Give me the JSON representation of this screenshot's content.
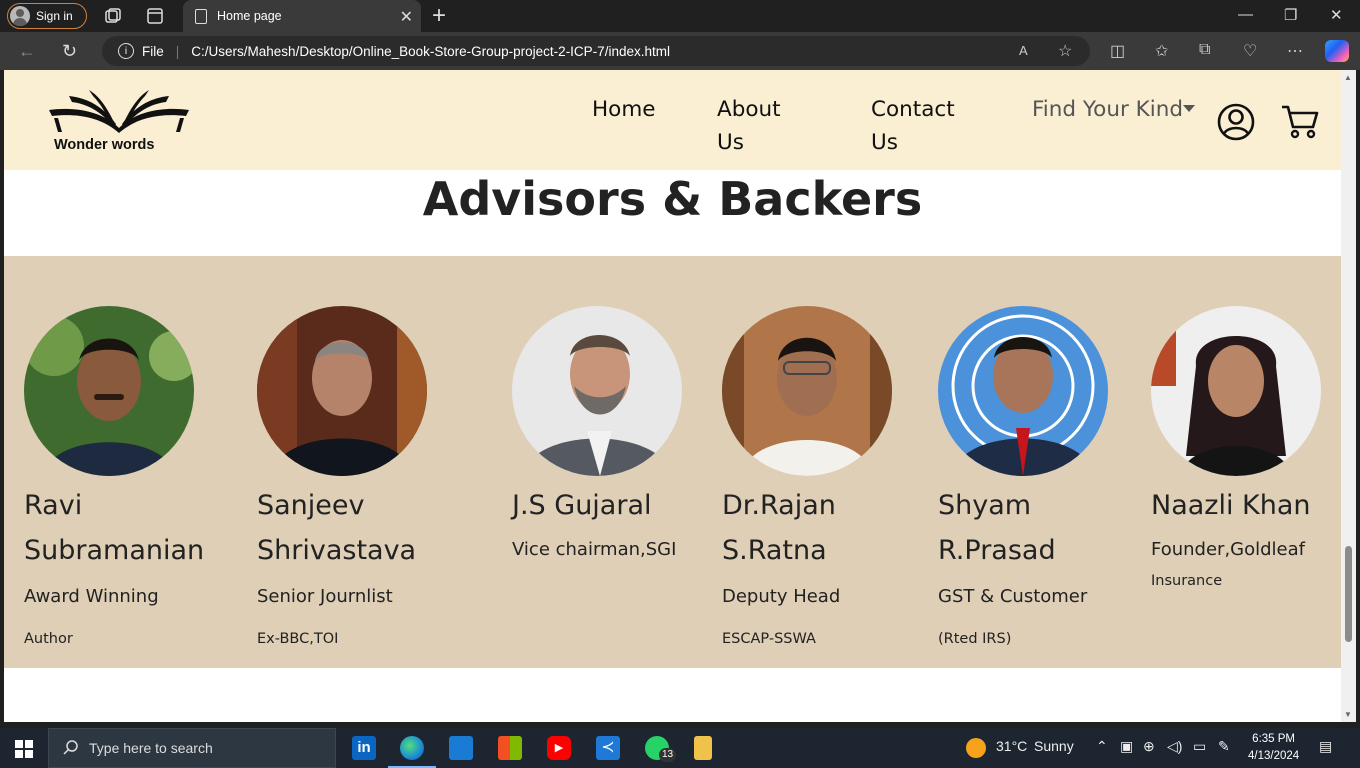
{
  "browser": {
    "signin_label": "Sign in",
    "tab_title": "Home page",
    "address_prefix": "File",
    "url": "C:/Users/Mahesh/Desktop/Online_Book-Store-Group-project-2-ICP-7/index.html"
  },
  "site": {
    "logo_text": "Wonder words",
    "nav": [
      {
        "label": "Home"
      },
      {
        "label": "About\nUs"
      },
      {
        "label": "Contact\nUs"
      }
    ],
    "dropdown_label": "Find Your Kind"
  },
  "advisors": {
    "title": "Advisors & Backers",
    "people": [
      {
        "name": "Ravi\nSubramanian",
        "role": "Award Winning",
        "sub": "Author"
      },
      {
        "name": "Sanjeev\nShrivastava",
        "role": "Senior Journlist",
        "sub": "Ex-BBC,TOI"
      },
      {
        "name": "J.S Gujaral",
        "role": "Vice chairman,SGI",
        "sub": ""
      },
      {
        "name": "Dr.Rajan\nS.Ratna",
        "role": "Deputy Head",
        "sub": "ESCAP-SSWA"
      },
      {
        "name": "Shyam\nR.Prasad",
        "role": "GST & Customer",
        "sub": "(Rted IRS)"
      },
      {
        "name": "Naazli Khan",
        "role": "Founder,Goldleaf",
        "sub": "Insurance"
      }
    ]
  },
  "taskbar": {
    "search_placeholder": "Type here to search",
    "whatsapp_badge": "13",
    "weather_temp": "31°C",
    "weather_desc": "Sunny",
    "time": "6:35 PM",
    "date": "4/13/2024"
  }
}
